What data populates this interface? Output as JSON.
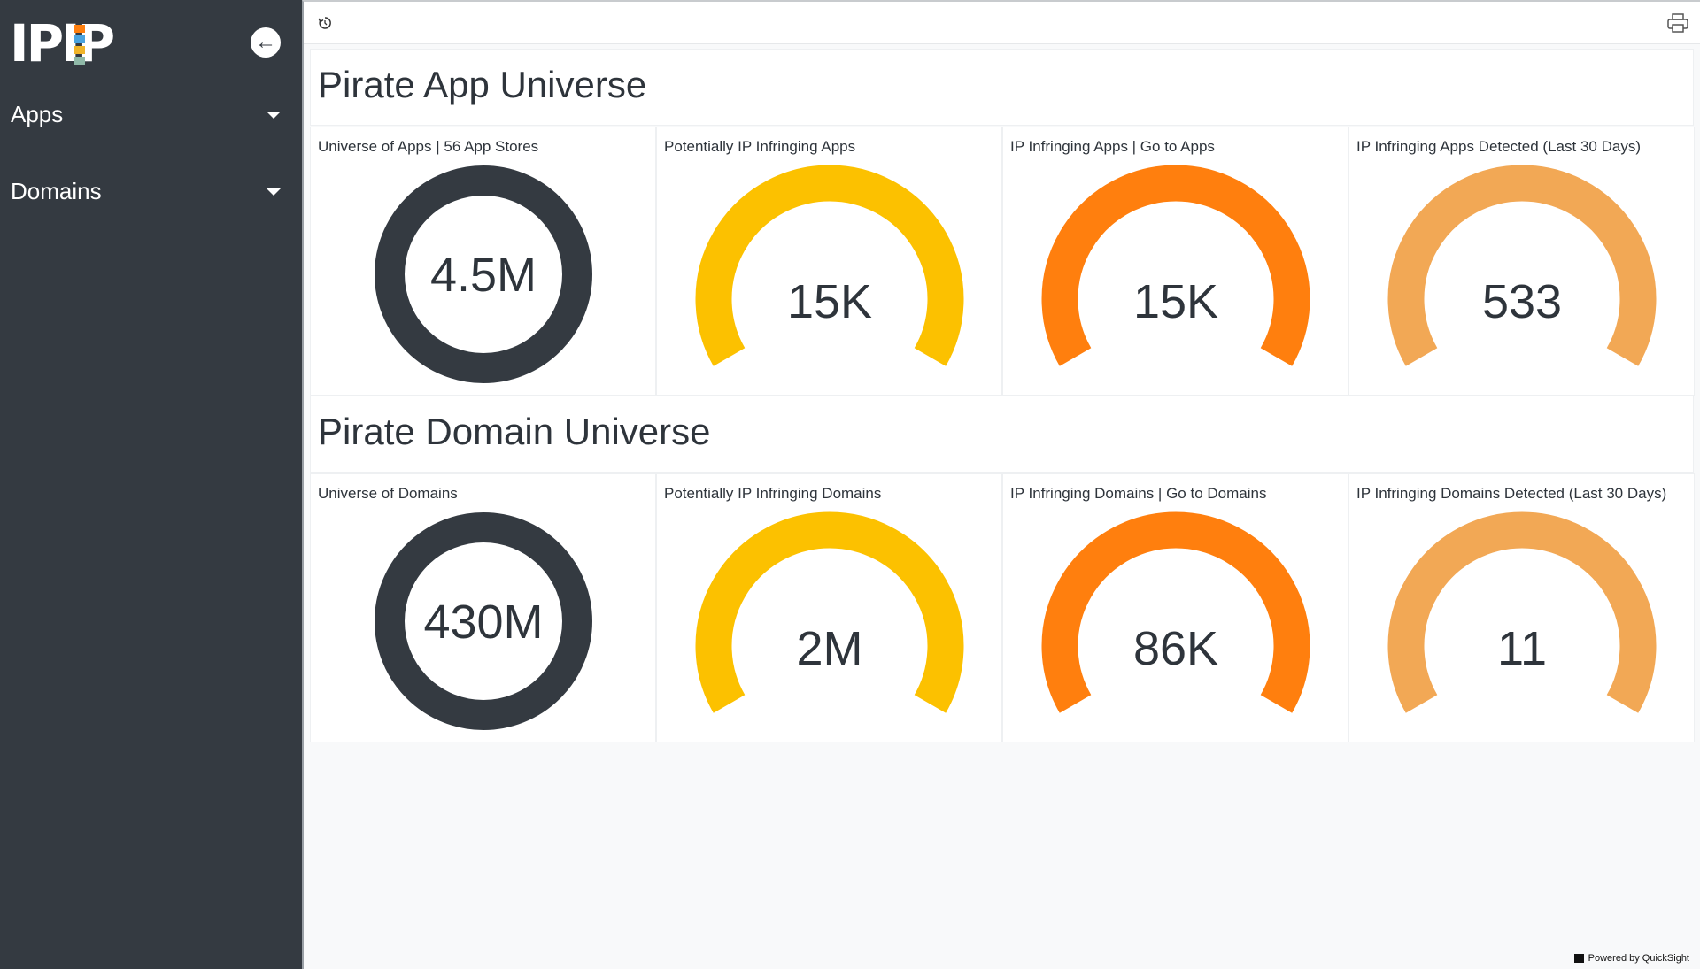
{
  "sidebar": {
    "logo_text": "IPIP",
    "nav": [
      {
        "label": "Apps"
      },
      {
        "label": "Domains"
      }
    ]
  },
  "sections": [
    {
      "title": "Pirate App Universe",
      "tiles": [
        {
          "title": "Universe of Apps | 56 App Stores",
          "value": "4.5M",
          "kind": "donut",
          "color": "#343a41"
        },
        {
          "title": "Potentially IP Infringing Apps",
          "value": "15K",
          "kind": "gauge",
          "color": "#fcc100"
        },
        {
          "title": "IP Infringing Apps | Go to Apps",
          "value": "15K",
          "kind": "gauge",
          "color": "#ff7f0e"
        },
        {
          "title": "IP Infringing Apps Detected (Last 30 Days)",
          "value": "533",
          "kind": "gauge",
          "color": "#f2a855"
        }
      ]
    },
    {
      "title": "Pirate Domain Universe",
      "tiles": [
        {
          "title": "Universe of Domains",
          "value": "430M",
          "kind": "donut",
          "color": "#343a41"
        },
        {
          "title": "Potentially IP Infringing Domains",
          "value": "2M",
          "kind": "gauge",
          "color": "#fcc100"
        },
        {
          "title": "IP Infringing Domains | Go to Domains",
          "value": "86K",
          "kind": "gauge",
          "color": "#ff7f0e"
        },
        {
          "title": "IP Infringing Domains Detected (Last 30 Days)",
          "value": "11",
          "kind": "gauge",
          "color": "#f2a855"
        }
      ]
    }
  ],
  "footer": {
    "powered_by": "Powered by QuickSight"
  },
  "icons": {
    "back": "arrow-left-icon",
    "reset": "reset-icon",
    "print": "print-icon",
    "caret": "caret-down-icon"
  }
}
